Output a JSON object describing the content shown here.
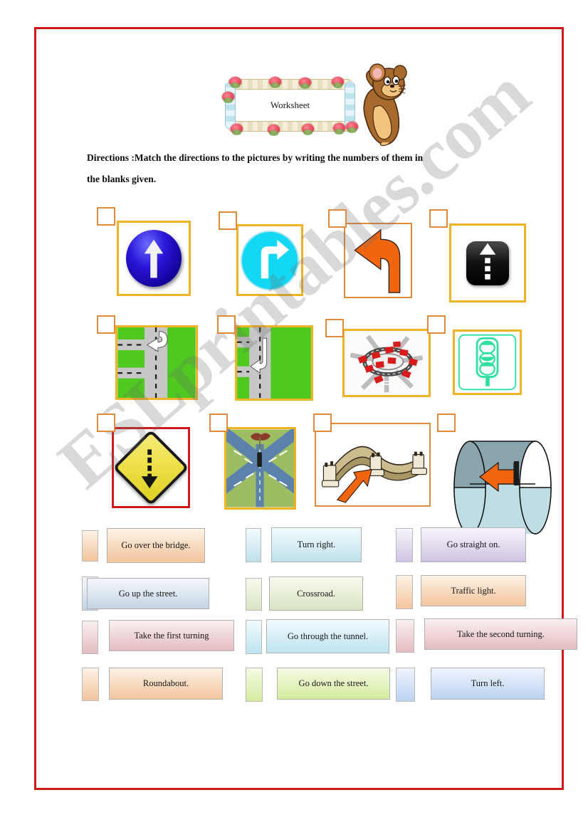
{
  "page": {
    "border_color": "#cc1b1b",
    "background": "#ffffff"
  },
  "watermark": {
    "text": "ESLprintables.com"
  },
  "title": {
    "text": "Worksheet",
    "decoration": "floral-ribbon-frame",
    "mascot": "jerry-mouse"
  },
  "directions": {
    "line1": "Directions :Match the directions to the pictures  by writing the numbers of them  in",
    "line2": "the blanks  given."
  },
  "pictures": {
    "rows": [
      [
        {
          "name": "go-straight-on-blue-sign",
          "blank_value": "",
          "frame_color": "#f0b323"
        },
        {
          "name": "turn-right-cyan-sign",
          "blank_value": "",
          "frame_color": "#f0b323"
        },
        {
          "name": "turn-left-orange-arrow",
          "blank_value": "",
          "frame_color": "#e08a3c"
        },
        {
          "name": "go-up-the-street-black-sign",
          "blank_value": "",
          "frame_color": "#f0b323"
        }
      ],
      [
        {
          "name": "take-the-first-turning-road-map",
          "blank_value": "",
          "frame_color": "#f0b323"
        },
        {
          "name": "take-the-second-turning-road-map",
          "blank_value": "",
          "frame_color": "#f0b323"
        },
        {
          "name": "roundabout-photo",
          "blank_value": "",
          "frame_color": "#f0b323"
        },
        {
          "name": "traffic-light-green-icon",
          "blank_value": "",
          "frame_color": "#f0b323"
        }
      ],
      [
        {
          "name": "go-down-the-street-yellow-diamond",
          "blank_value": "",
          "frame_color": "#cc1b1b"
        },
        {
          "name": "crossroad-aerial-map",
          "blank_value": "",
          "frame_color": "#f0b323"
        },
        {
          "name": "go-over-the-bridge-arch",
          "blank_value": "",
          "frame_color": "#e08a3c"
        },
        {
          "name": "go-through-the-tunnel-cylinder",
          "blank_value": "",
          "frame_color": "#e08a3c"
        }
      ]
    ]
  },
  "answers": {
    "rows": [
      [
        {
          "label": "Go over the bridge.",
          "value": "",
          "style": "g-peach"
        },
        {
          "label": "Turn right.",
          "value": "",
          "style": "g-blue"
        },
        {
          "label": "Go straight on.",
          "value": "",
          "style": "g-lav"
        }
      ],
      [
        {
          "label": "Go up the street.",
          "value": "",
          "style": "g-steel"
        },
        {
          "label": "Crossroad.",
          "value": "",
          "style": "g-sage"
        },
        {
          "label": "Traffic light.",
          "value": "",
          "style": "g-peach"
        }
      ],
      [
        {
          "label": "Take the first turning",
          "value": "",
          "style": "g-rose"
        },
        {
          "label": "Go through the tunnel.",
          "value": "",
          "style": "g-sky"
        },
        {
          "label": "Take the second turning.",
          "value": "",
          "style": "g-rose"
        }
      ],
      [
        {
          "label": "Roundabout.",
          "value": "",
          "style": "g-peach"
        },
        {
          "label": "Go down the street.",
          "value": "",
          "style": "g-lime"
        },
        {
          "label": "Turn left.",
          "value": "",
          "style": "g-corn"
        }
      ]
    ]
  }
}
